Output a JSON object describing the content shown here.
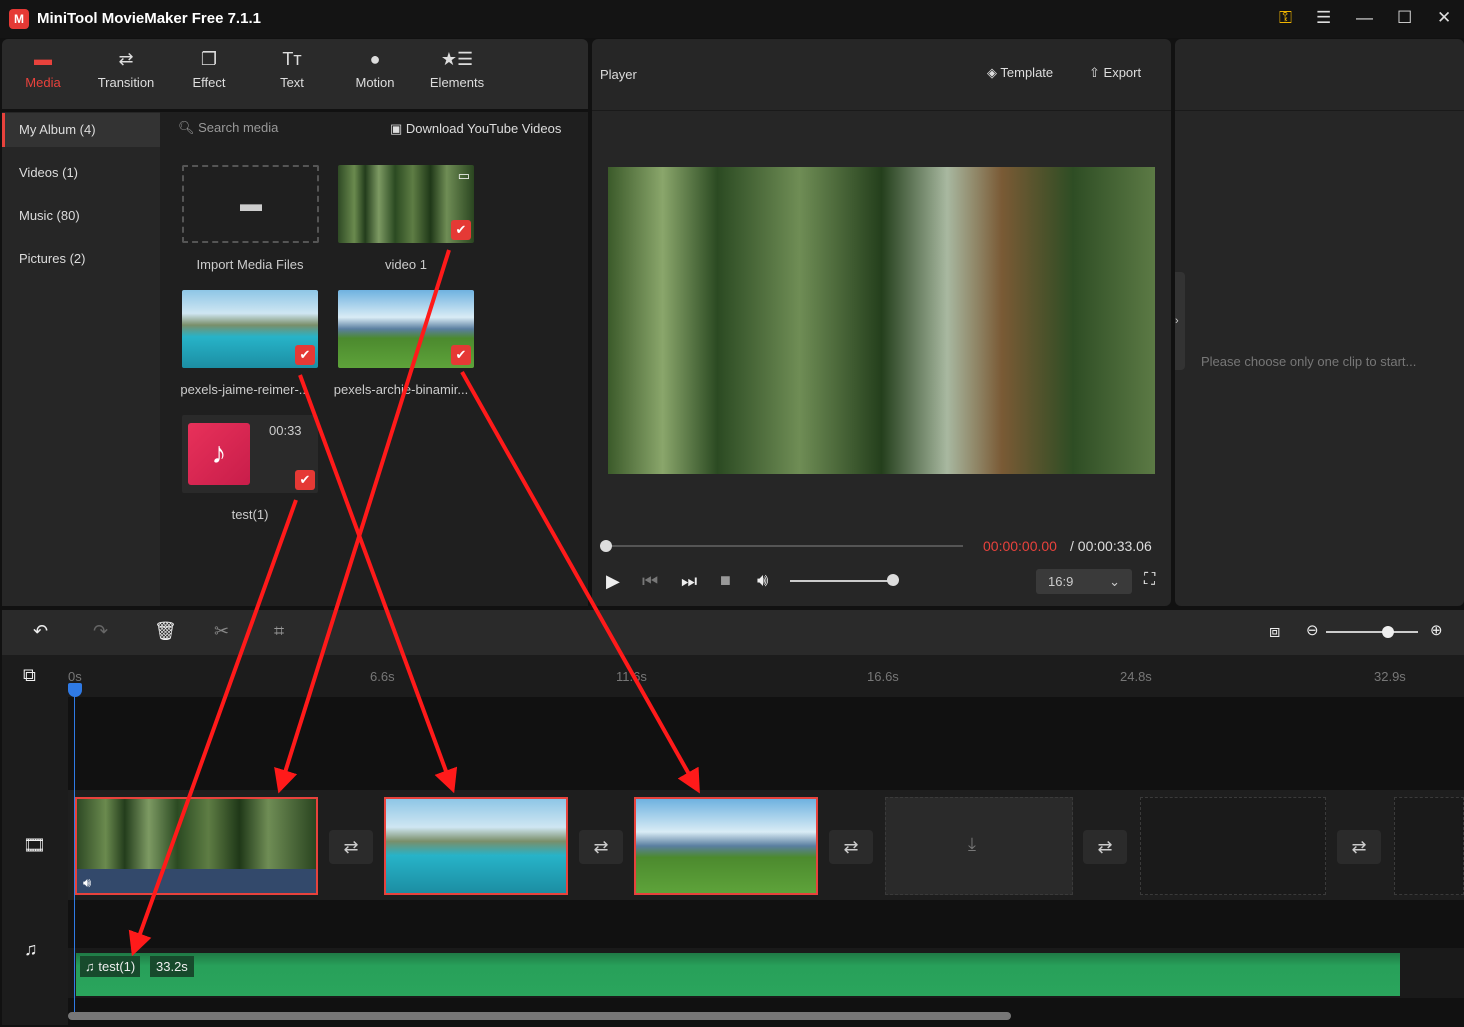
{
  "app": {
    "title": "MiniTool MovieMaker Free 7.1.1"
  },
  "window_controls": [
    "key-icon",
    "menu-icon",
    "minimize-icon",
    "maximize-icon",
    "close-icon"
  ],
  "tabs": [
    {
      "label": "Media",
      "icon": "folder-icon",
      "active": true
    },
    {
      "label": "Transition",
      "icon": "swap-icon"
    },
    {
      "label": "Effect",
      "icon": "layers-icon"
    },
    {
      "label": "Text",
      "icon": "text-icon"
    },
    {
      "label": "Motion",
      "icon": "motion-icon"
    },
    {
      "label": "Elements",
      "icon": "elements-icon"
    }
  ],
  "sidebar": {
    "items": [
      {
        "label": "My Album (4)",
        "active": true
      },
      {
        "label": "Videos (1)"
      },
      {
        "label": "Music (80)"
      },
      {
        "label": "Pictures (2)"
      }
    ]
  },
  "media": {
    "search_placeholder": "Search media",
    "download_label": "Download YouTube Videos",
    "items": [
      {
        "label": "Import Media Files"
      },
      {
        "label": "video 1"
      },
      {
        "label": "pexels-jaime-reimer-..."
      },
      {
        "label": "pexels-archie-binamir..."
      },
      {
        "label": "test(1)",
        "duration": "00:33"
      }
    ]
  },
  "player": {
    "title": "Player",
    "template_label": "Template",
    "export_label": "Export",
    "current_time": "00:00:00.00",
    "total_time": "/ 00:00:33.06",
    "aspect": "16:9",
    "progress": 0,
    "volume": 0.8,
    "accent": "#e8423c"
  },
  "properties": {
    "placeholder": "Please choose only one clip to start..."
  },
  "timeline": {
    "ticks": [
      "0s",
      "6.6s",
      "11.6s",
      "16.6s",
      "24.8s",
      "32.9s"
    ],
    "audio": {
      "name": "test(1)",
      "duration": "33.2s"
    },
    "zoom": 0.75
  }
}
